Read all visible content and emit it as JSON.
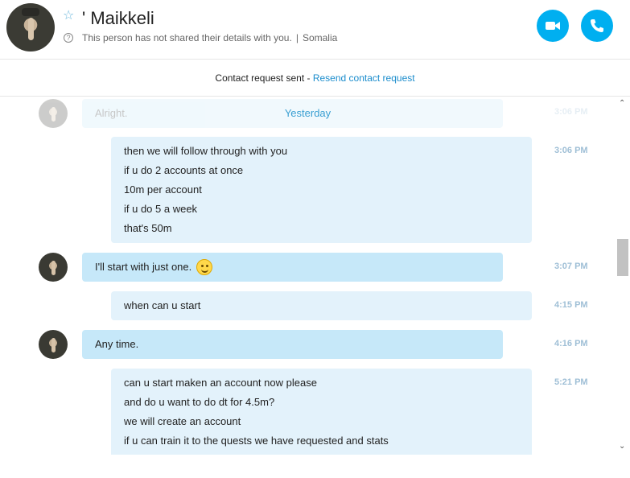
{
  "header": {
    "name": "' Maikkeli",
    "status": "This person has not shared their details with you.",
    "location": "Somalia",
    "separator": "|",
    "video_icon": "video-camera-icon",
    "audio_icon": "phone-icon",
    "accent": "#00aff0"
  },
  "request_bar": {
    "text": "Contact request sent - ",
    "link": "Resend contact request"
  },
  "chat": {
    "faded_message": "Alright.",
    "faded_time": "3:06 PM",
    "date_separator": "Yesterday",
    "messages": [
      {
        "time": "3:06 PM",
        "lines": [
          "then we will follow through with you",
          "if u do 2 accounts at once",
          "10m per account",
          "if u do 5 a week",
          "that's 50m"
        ]
      },
      {
        "time": "3:07 PM",
        "lines": [
          "I'll start with just one."
        ]
      },
      {
        "time": "4:15 PM",
        "lines": [
          "when can u start"
        ]
      },
      {
        "time": "4:16 PM",
        "lines": [
          "Any time."
        ]
      },
      {
        "time": "5:21 PM",
        "lines": [
          "can u start maken an account now please",
          "and do u want to do dt for 4.5m?",
          "we will create an account",
          "if u can train it to the quests we have requested and stats"
        ]
      }
    ]
  },
  "scrollbar": {
    "up_glyph": "⌃",
    "down_glyph": "⌄"
  }
}
